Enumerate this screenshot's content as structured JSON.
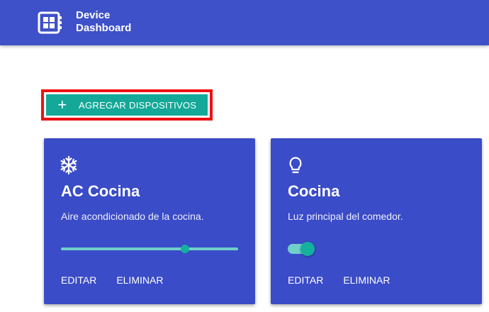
{
  "header": {
    "title": "Device\nDashboard",
    "title_line1": "Device",
    "title_line2": "Dashboard",
    "icon": "dashboard-icon",
    "bg_color": "#3f51c8"
  },
  "toolbar": {
    "add_label": "AGREGAR DISPOSITIVOS",
    "add_icon": "plus-icon",
    "add_color": "#13a897",
    "highlight_color": "#ee1111"
  },
  "devices": [
    {
      "title": "AC Cocina",
      "description": "Aire acondicionado de la cocina.",
      "icon": "snowflake-icon",
      "control": "slider",
      "level": 0.7,
      "edit_label": "EDITAR",
      "delete_label": "ELIMINAR"
    },
    {
      "title": "Cocina",
      "description": "Luz principal del comedor.",
      "icon": "lightbulb-icon",
      "control": "toggle",
      "on": true,
      "edit_label": "EDITAR",
      "delete_label": "ELIMINAR"
    }
  ],
  "colors": {
    "card": "#3a4cc7",
    "accent": "#16b09e",
    "accent_light": "#6fd0c8"
  }
}
